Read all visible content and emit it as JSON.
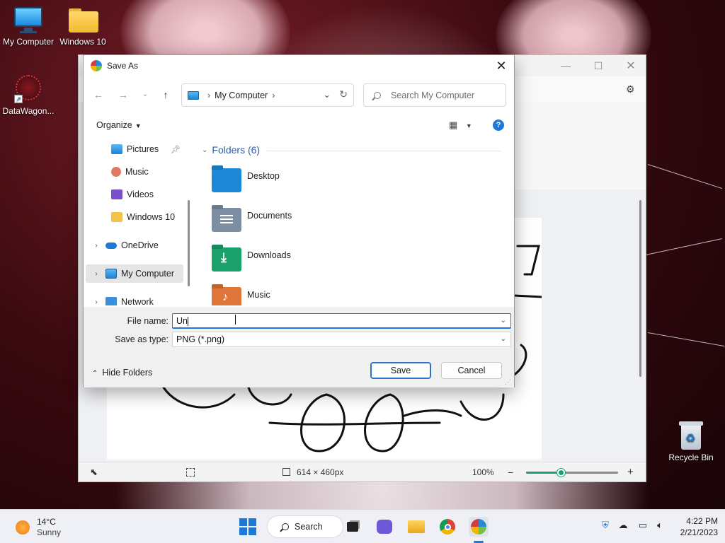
{
  "desktop": {
    "icons": [
      {
        "label": "My Computer",
        "icon": "monitor-icon"
      },
      {
        "label": "Windows 10",
        "icon": "folder-icon"
      },
      {
        "label": "DataWagon...",
        "icon": "datawagon-shortcut-icon"
      }
    ],
    "recycle_bin": {
      "label": "Recycle Bin",
      "icon": "recycle-bin-icon"
    }
  },
  "paint": {
    "status": {
      "canvas_size": "614 × 460px",
      "zoom": "100%",
      "zoom_level": 0.38
    }
  },
  "dialog": {
    "title": "Save As",
    "address": {
      "location": "My Computer"
    },
    "search_placeholder": "Search My Computer",
    "organize_label": "Organize",
    "nav": [
      {
        "label": "Pictures",
        "icon": "pictures-icon",
        "pinned": true
      },
      {
        "label": "Music",
        "icon": "music-icon"
      },
      {
        "label": "Videos",
        "icon": "videos-icon"
      },
      {
        "label": "Windows 10",
        "icon": "folder-icon"
      },
      {
        "label": "OneDrive",
        "icon": "onedrive-icon"
      },
      {
        "label": "My Computer",
        "icon": "monitor-icon",
        "selected": true
      },
      {
        "label": "Network",
        "icon": "network-icon"
      }
    ],
    "group_header": "Folders (6)",
    "folders": [
      {
        "name": "Desktop",
        "color": "#1e88d8"
      },
      {
        "name": "Documents",
        "color": "#7e8fa3"
      },
      {
        "name": "Downloads",
        "color": "#1aa06b"
      },
      {
        "name": "Music",
        "color": "#e0763a"
      }
    ],
    "file_name_label": "File name:",
    "file_name_value": "Un",
    "save_type_label": "Save as type:",
    "save_type_value": "PNG (*.png)",
    "hide_folders_label": "Hide Folders",
    "save_button": "Save",
    "cancel_button": "Cancel"
  },
  "taskbar": {
    "weather": {
      "temp": "14°C",
      "condition": "Sunny"
    },
    "search_label": "Search",
    "time": "4:22 PM",
    "date": "2/21/2023"
  },
  "colors": {
    "accent": "#1e78d6",
    "zoom_green": "#1aa179"
  }
}
